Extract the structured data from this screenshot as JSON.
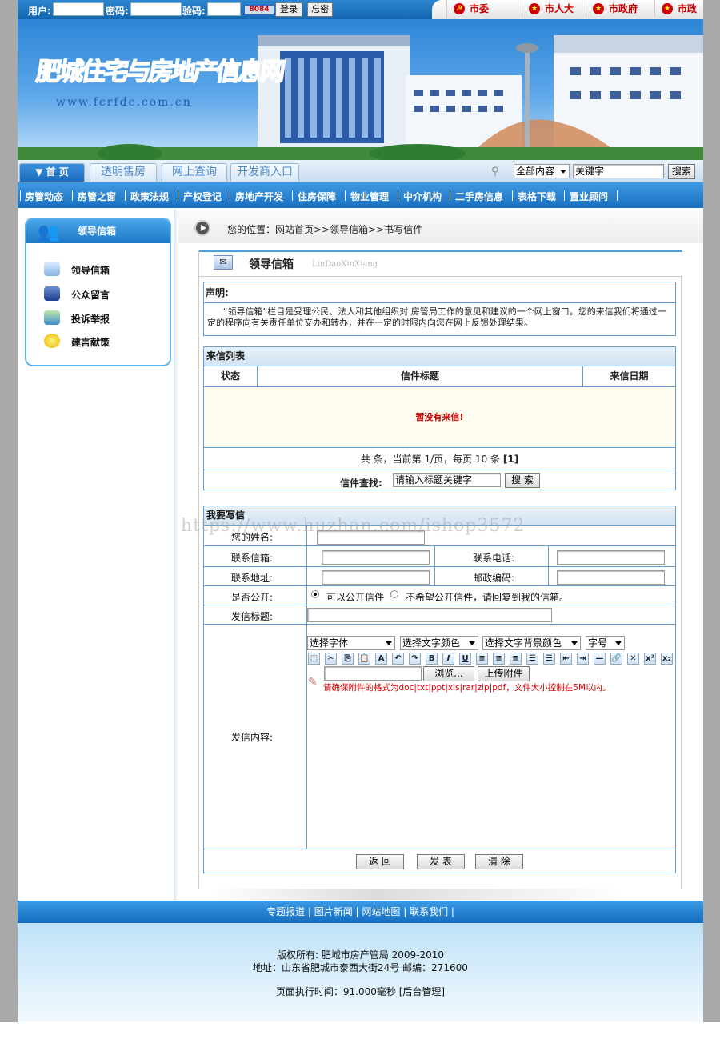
{
  "login": {
    "user_label": "用户:",
    "password_label": "密码:",
    "captcha_label": "验码:",
    "captcha_value": "8084",
    "login_button": "登录",
    "forgot_button": "忘密"
  },
  "gov_links": [
    "市委",
    "市人大",
    "市政府",
    "市政协"
  ],
  "banner": {
    "logo_text": "肥城住宅与房地产信息网",
    "logo_url": "www.fcrfdc.com.cn"
  },
  "tabs": [
    "首 页",
    "透明售房",
    "网上查询",
    "开发商入口"
  ],
  "search": {
    "scope": "全部内容",
    "keyword": "关键字",
    "button": "搜索"
  },
  "menu": [
    "房管动态",
    "房管之窗",
    "政策法规",
    "产权登记",
    "房地产开发",
    "住房保障",
    "物业管理",
    "中介机构",
    "二手房信息",
    "表格下载",
    "置业顾问"
  ],
  "sidebar": {
    "title": "领导信箱",
    "items": [
      "领导信箱",
      "公众留言",
      "投诉举报",
      "建言献策"
    ]
  },
  "breadcrumb": {
    "label": "您的位置：",
    "path": "网站首页>>领导信箱>>书写信件"
  },
  "panel": {
    "title": "领导信箱",
    "title_pinyin": "LinDaoXinXiang"
  },
  "declaration": {
    "heading": "声明:",
    "text": "“领导信箱”栏目是受理公民、法人和其他组织对 房管局工作的意见和建议的一个网上窗口。您的来信我们将通过一定的程序向有关责任单位交办和转办，并在一定的时限内向您在网上反馈处理结果。"
  },
  "letters": {
    "heading": "来信列表",
    "columns": [
      "状态",
      "信件标题",
      "来信日期"
    ],
    "empty_text": "暂没有来信!",
    "pagination": "共 条，当前第 1/页，每页 10 条",
    "pagination_end": "[1]",
    "search_label": "信件查找:",
    "search_placeholder": "请输入标题关键字",
    "search_button": "搜 索"
  },
  "write": {
    "heading": "我要写信",
    "name_label": "您的姓名:",
    "email_label": "联系信箱:",
    "phone_label": "联系电话:",
    "address_label": "联系地址:",
    "postcode_label": "邮政编码:",
    "public_label": "是否公开:",
    "public_yes": "可以公开信件",
    "public_no": "不希望公开信件，请回复到我的信箱。",
    "subject_label": "发信标题:",
    "content_label": "发信内容:",
    "font_select": "选择字体",
    "color_select": "选择文字颜色",
    "bgcolor_select": "选择文字背景颜色",
    "size_select": "字号",
    "browse_button": "浏览...",
    "upload_button": "上传附件",
    "attach_note": "请确保附件的格式为doc|txt|ppt|xls|rar|zip|pdf，文件大小控制在5M以内。",
    "back_button": "返 回",
    "send_button": "发 表",
    "clear_button": "清 除"
  },
  "footer": {
    "links": "专题报道 | 图片新闻 | 网站地图 | 联系我们 |",
    "copyright": "版权所有:  肥城市房产管局 2009-2010",
    "address": "地址：山东省肥城市泰西大街24号  邮编：271600",
    "exec_time": "页面执行时间：91.000毫秒  [后台管理]"
  },
  "watermark": "https://www.huzhan.com/ishop3572"
}
